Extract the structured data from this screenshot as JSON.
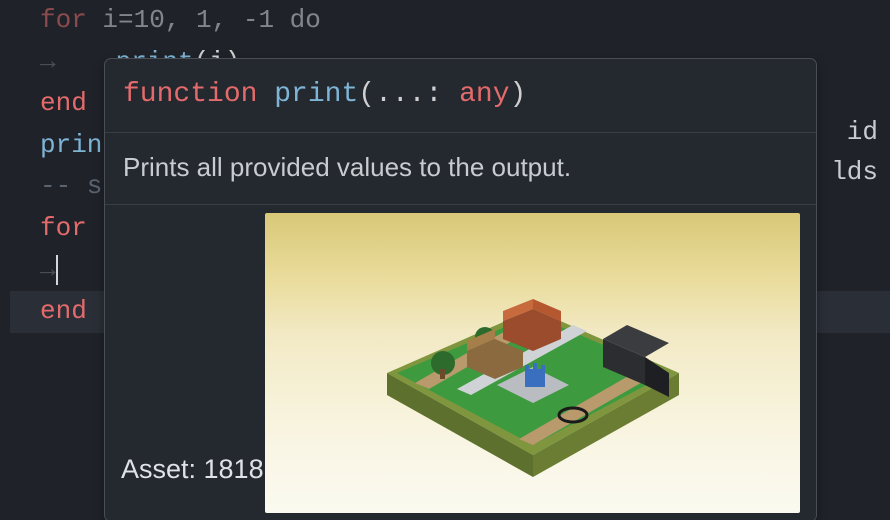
{
  "code": {
    "line1_for": "for",
    "line1_rest": " i=10, 1, -1 do",
    "line2_fn": "print",
    "line2_lp": "(",
    "line2_var": "i",
    "line2_rp": ")",
    "line3_end": "end",
    "line4_fn": "prin",
    "right_id": "id",
    "line5_prefix": "-- s",
    "right_lds": "lds",
    "line6_for": "for",
    "line8_end": "end",
    "indent_arrow": "→"
  },
  "tooltip": {
    "sig_kw": "function",
    "sig_name": "print",
    "sig_lp": "(",
    "sig_arg": "...",
    "sig_colon": ": ",
    "sig_type": "any",
    "sig_rp": ")",
    "description": "Prints all provided values to the output.",
    "asset_label": "Asset: 1818"
  }
}
